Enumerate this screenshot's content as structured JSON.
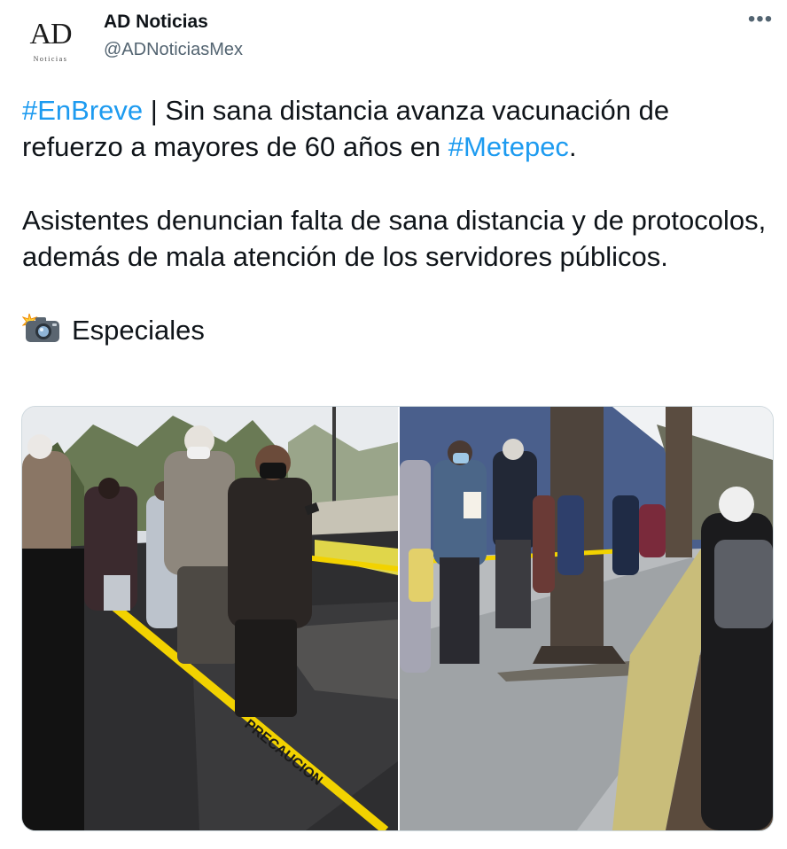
{
  "account": {
    "avatar_text": "AD",
    "avatar_subtext": "Noticias",
    "display_name": "AD Noticias",
    "handle": "@ADNoticiasMex"
  },
  "more_icon": "•••",
  "tweet": {
    "hashtag_1": "#EnBreve",
    "line1_rest": " | Sin sana distancia avanza vacunación de refuerzo a mayores de 60 años en ",
    "hashtag_2": "#Metepec",
    "line1_end": ".",
    "paragraph_2": "Asistentes denuncian falta de sana distancia y de protocolos, además de mala atención de los servidores públicos.",
    "credit_icon": "camera-flash-icon",
    "credit": "Especiales"
  },
  "media": {
    "photo_1": "people-waiting-line-street-photo",
    "photo_2": "people-waiting-line-sidewalk-photo",
    "tape_text": "PRECAUCION"
  },
  "colors": {
    "link": "#1d9bf0",
    "secondary": "#536471",
    "text": "#0f1419",
    "border": "#cfd9de"
  }
}
